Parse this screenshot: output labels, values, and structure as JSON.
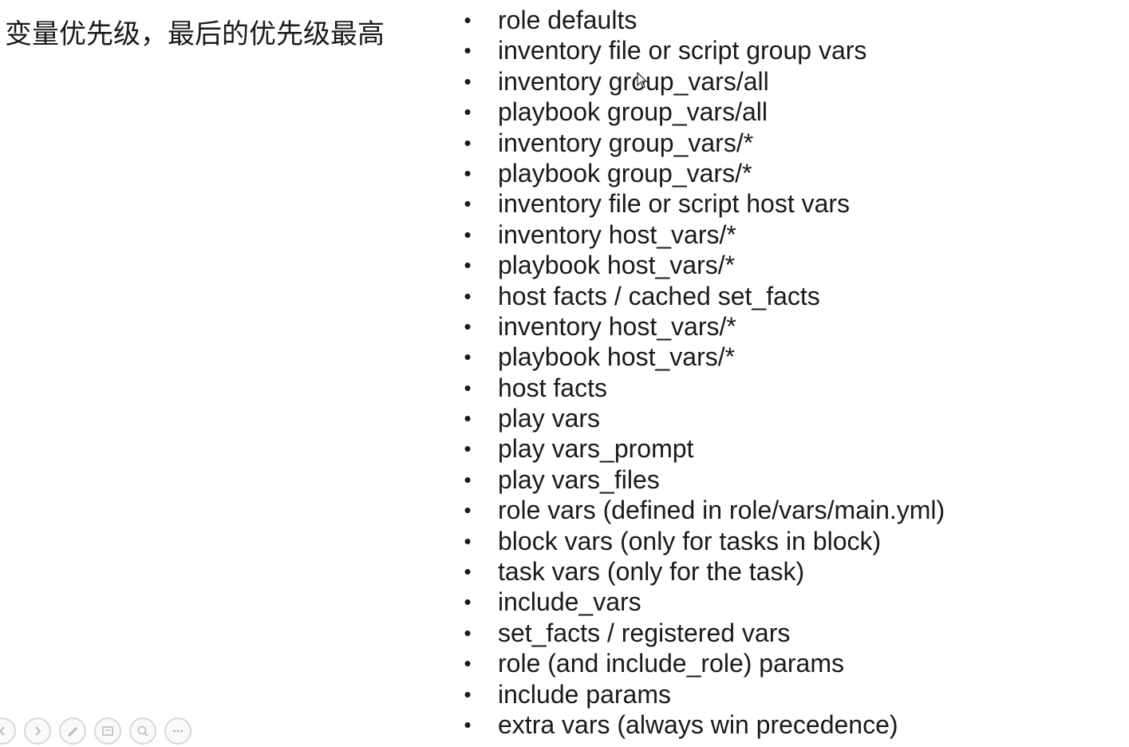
{
  "slide": {
    "title": "变量优先级，最后的优先级最高",
    "bullet": "•",
    "items": [
      "role defaults",
      "inventory file or script group vars",
      "inventory group_vars/all",
      "playbook group_vars/all",
      "inventory group_vars/*",
      "playbook group_vars/*",
      "inventory file or script host vars",
      "inventory host_vars/*",
      "playbook host_vars/*",
      "host facts / cached set_facts",
      "inventory host_vars/*",
      "playbook host_vars/*",
      "host facts",
      "play vars",
      "play vars_prompt",
      "play vars_files",
      "role vars (defined in role/vars/main.yml)",
      "block vars (only for tasks in block)",
      "task vars (only for the task)",
      "include_vars",
      "set_facts / registered vars",
      "role (and include_role) params",
      "include params",
      "extra vars (always win precedence)"
    ]
  },
  "toolbar": {
    "icons": [
      "back-icon",
      "play-icon",
      "pen-icon",
      "slides-icon",
      "zoom-icon",
      "more-icon"
    ]
  },
  "colors": {
    "background": "#ffffff",
    "text": "#1a1a1a",
    "toolbar_border": "#d8d8d8"
  }
}
